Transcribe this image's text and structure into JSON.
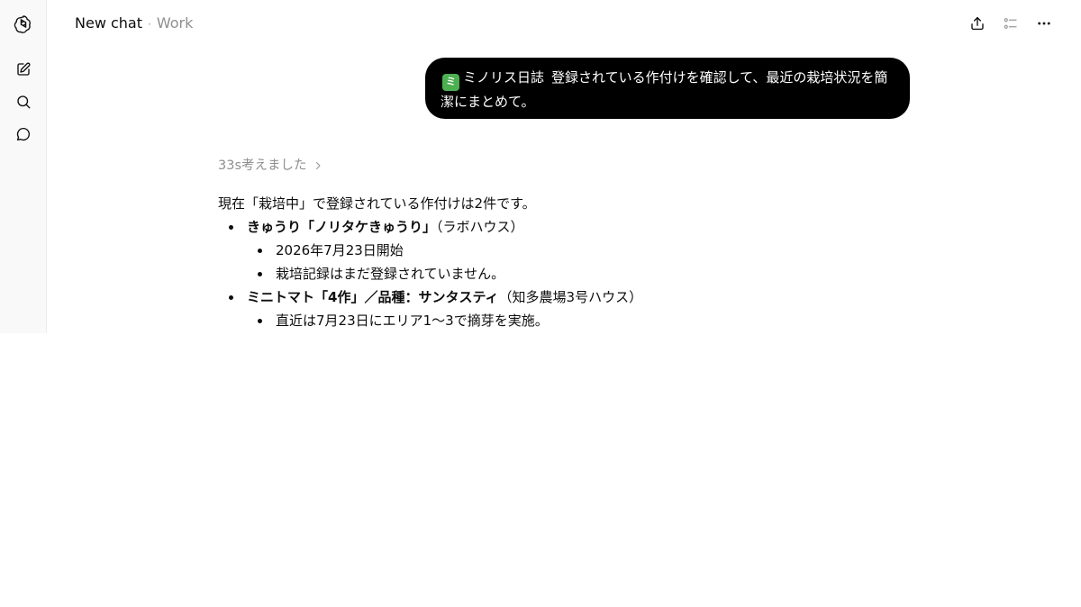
{
  "header": {
    "chat_title": "New chat",
    "separator": "·",
    "project": "Work"
  },
  "icons": {
    "logo": "openai-logo-icon",
    "new_chat": "edit-icon",
    "search": "search-icon",
    "chats": "chat-bubble-icon",
    "share": "share-icon",
    "toc": "outline-list-icon",
    "more": "more-horizontal-icon"
  },
  "user_message": {
    "connector_badge": "ミ",
    "connector_name": "ミノリス日誌",
    "text": "登録されている作付けを確認して、最近の栽培状況を簡潔にまとめて。"
  },
  "assistant": {
    "thought_label": "33s考えました",
    "intro": "現在「栽培中」で登録されている作付けは2件です。",
    "items": [
      {
        "title": "きゅうり「ノリタケきゅうり」",
        "location": "（ラボハウス）",
        "details": [
          "2026年7月23日開始",
          "栽培記録はまだ登録されていません。"
        ]
      },
      {
        "title": "ミニトマト「4作」／品種：サンタスティ",
        "location": "（知多農場3号ハウス）",
        "details": [
          "直近は7月23日にエリア1〜3で摘芽を実施。"
        ]
      }
    ]
  },
  "colors": {
    "bubble_bg": "#000000",
    "connector_badge": "#4caf50",
    "muted_text": "#8f8f8f",
    "rail_bg": "#f9f9f9"
  }
}
